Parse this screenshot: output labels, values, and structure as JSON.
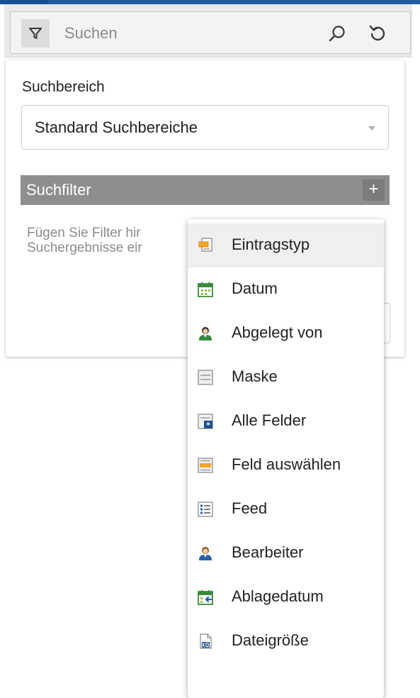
{
  "search": {
    "placeholder": "Suchen"
  },
  "panel": {
    "area_label": "Suchbereich",
    "area_value": "Standard Suchbereiche",
    "filter_title": "Suchfilter",
    "add_label": "+",
    "hint_line1": "Fügen Sie Filter hir",
    "hint_line2": "Suchergebnisse eir"
  },
  "menu": {
    "items": [
      {
        "label": "Eintragstyp",
        "icon": "entry-type-icon"
      },
      {
        "label": "Datum",
        "icon": "calendar-icon"
      },
      {
        "label": "Abgelegt von",
        "icon": "user-green-icon"
      },
      {
        "label": "Maske",
        "icon": "form-mask-icon"
      },
      {
        "label": "Alle Felder",
        "icon": "all-fields-icon"
      },
      {
        "label": "Feld auswählen",
        "icon": "select-field-icon"
      },
      {
        "label": "Feed",
        "icon": "feed-list-icon"
      },
      {
        "label": "Bearbeiter",
        "icon": "user-blue-icon"
      },
      {
        "label": "Ablagedatum",
        "icon": "filing-date-icon"
      },
      {
        "label": "Dateigröße",
        "icon": "file-size-icon"
      }
    ]
  },
  "colors": {
    "accent": "#1e5ea0",
    "header_gray": "#8e8e8e"
  }
}
